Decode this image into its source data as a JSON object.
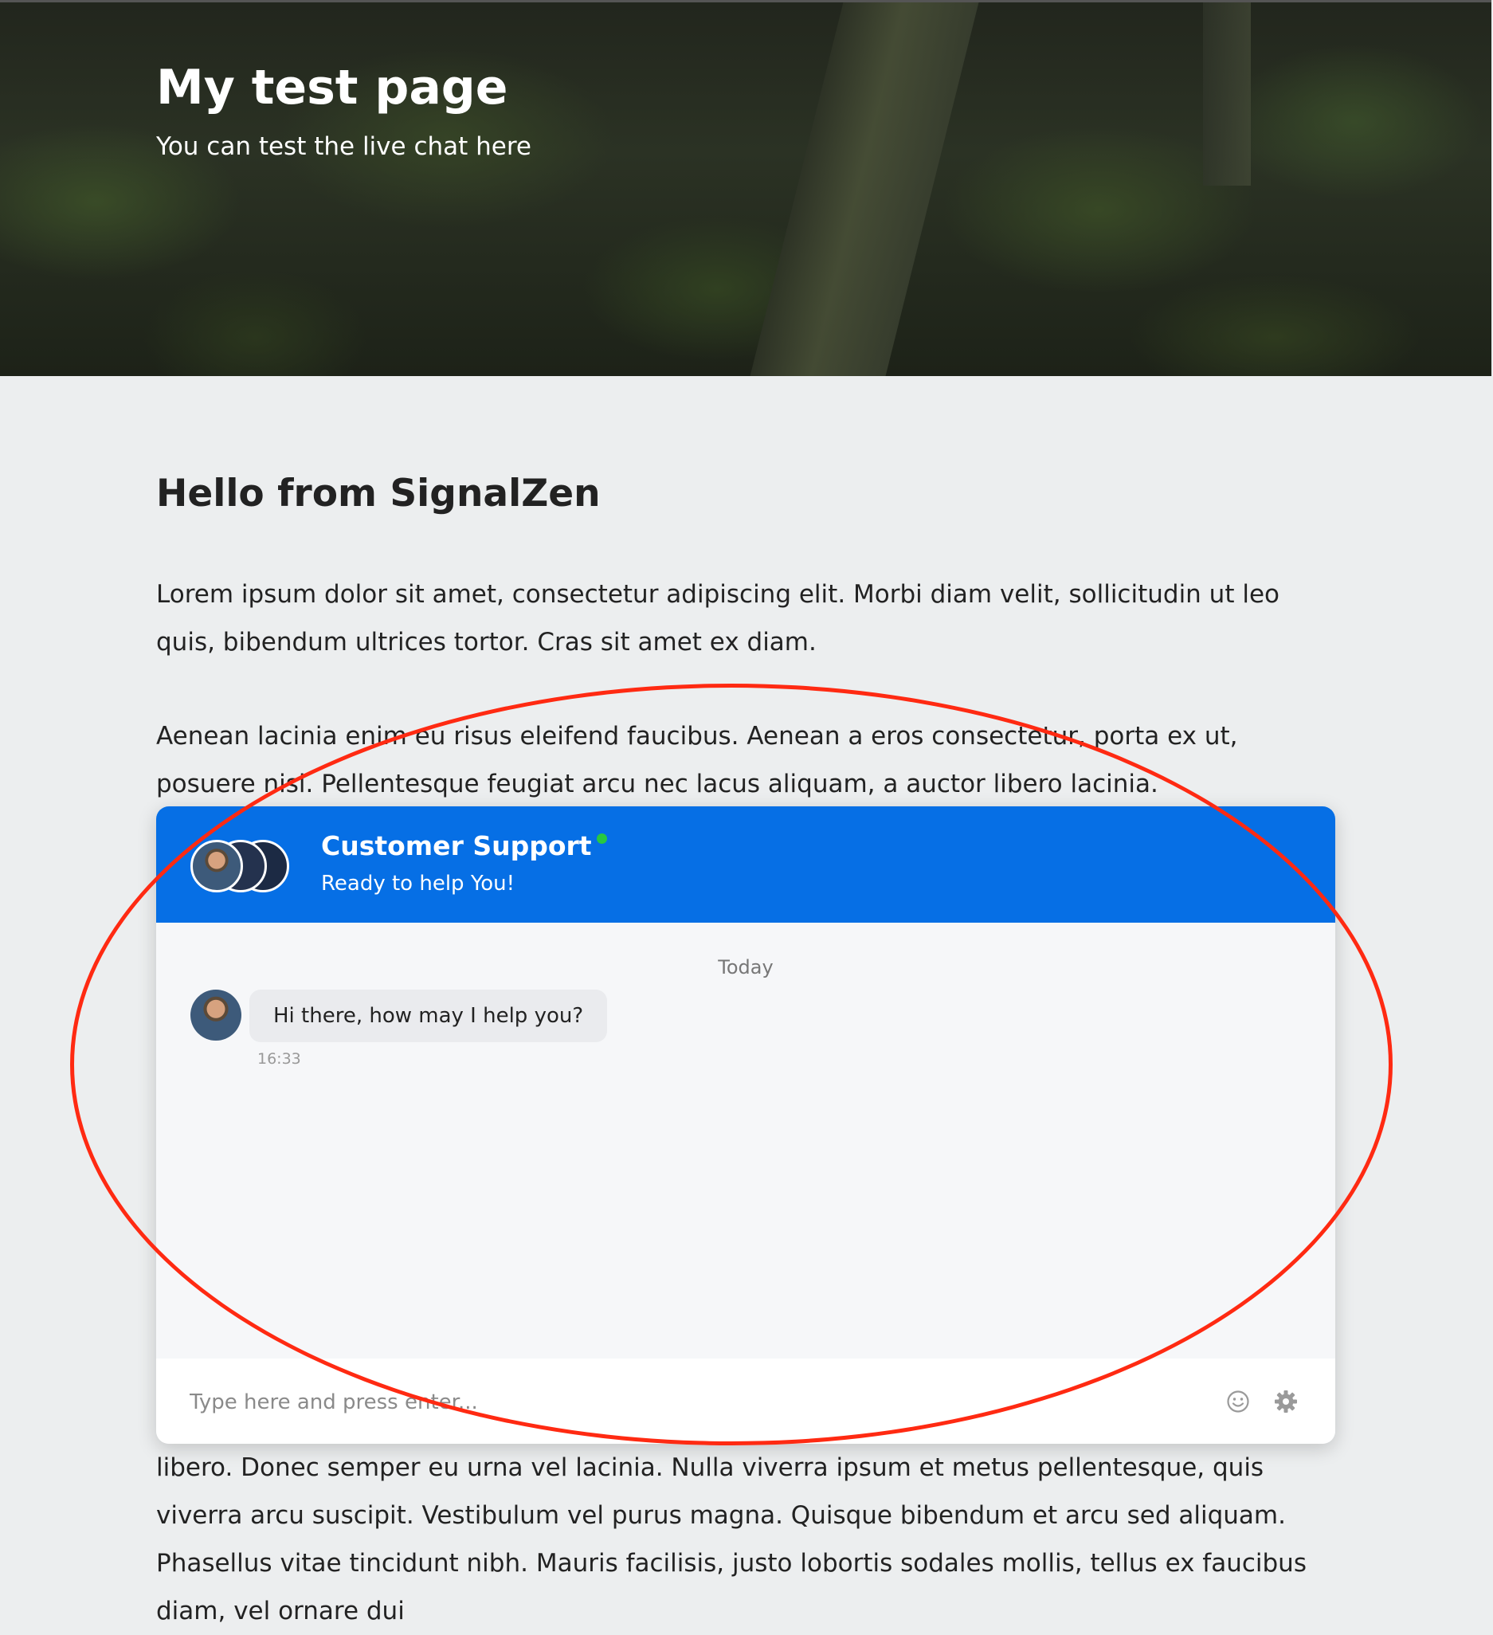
{
  "hero": {
    "title": "My test page",
    "subtitle": "You can test the live chat here"
  },
  "main": {
    "heading": "Hello from SignalZen",
    "paragraphs": [
      "Lorem ipsum dolor sit amet, consectetur adipiscing elit. Morbi diam velit, sollicitudin ut leo quis, bibendum ultrices tortor. Cras sit amet ex diam.",
      "Aenean lacinia enim eu risus eleifend faucibus. Aenean a eros consectetur, porta ex ut, posuere nisi. Pellentesque feugiat arcu nec lacus aliquam, a auctor libero lacinia.",
      "libero. Donec semper eu urna vel lacinia. Nulla viverra ipsum et metus pellentesque, quis viverra arcu suscipit. Vestibulum vel purus magna. Quisque bibendum et arcu sed aliquam. Phasellus vitae tincidunt nibh. Mauris facilisis, justo lobortis sodales mollis, tellus ex faucibus diam, vel ornare dui"
    ]
  },
  "chat": {
    "agent_name": "Customer Support",
    "status_text": "Ready to help You!",
    "online": true,
    "day_label": "Today",
    "messages": [
      {
        "from": "agent",
        "text": "Hi there, how may I help you?",
        "time": "16:33"
      }
    ],
    "input_placeholder": "Type here and press enter...",
    "icons": [
      "emoji-icon",
      "gear-icon"
    ]
  },
  "colors": {
    "header_blue": "#066fe5",
    "online_green": "#28c840",
    "annotation_red": "#ff2a12",
    "page_background": "#eceeef"
  }
}
